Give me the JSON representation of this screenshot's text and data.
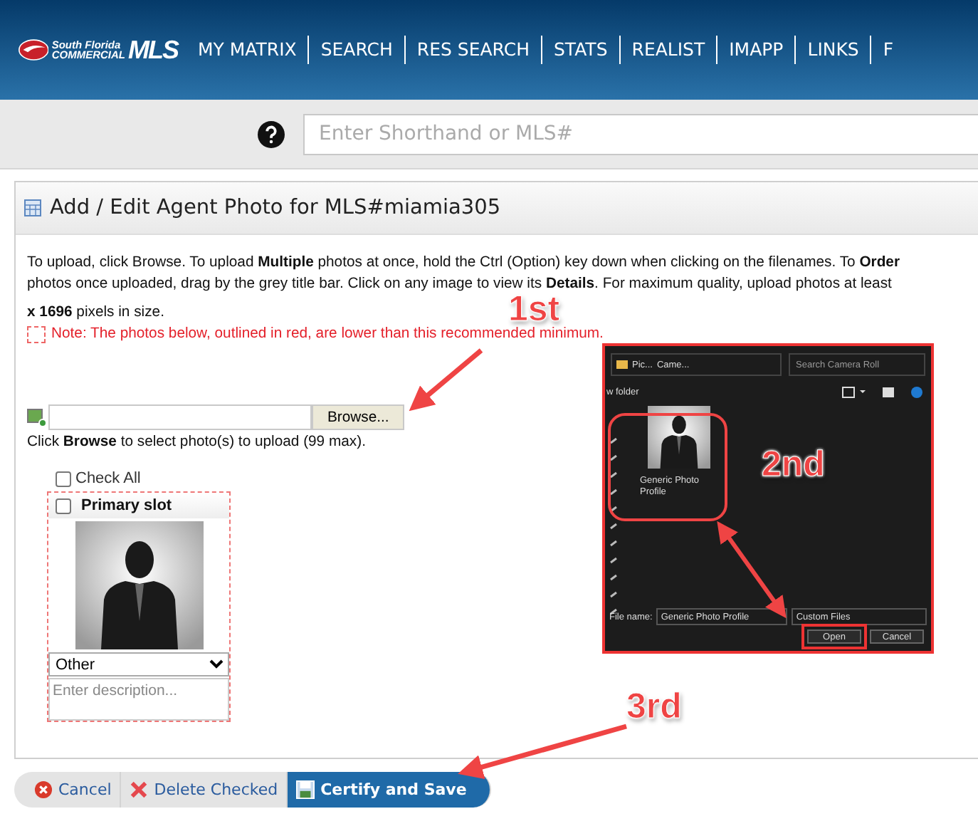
{
  "header": {
    "logo": {
      "line_1": "South Florida",
      "line_2": "COMMERCIAL",
      "mark": "MLS"
    },
    "nav": [
      "MY MATRIX",
      "SEARCH",
      "RES SEARCH",
      "STATS",
      "REALIST",
      "IMAPP",
      "LINKS",
      "F"
    ]
  },
  "search": {
    "placeholder": "Enter Shorthand or MLS#"
  },
  "panel": {
    "title": "Add / Edit Agent Photo for MLS#miamia305",
    "instructions": [
      "To upload, click Browse. To upload **Multiple** photos at once, hold the Ctrl (Option) key down when clicking on the filenames. To **Order**",
      "photos once uploaded, drag by the grey title bar. Click on any image to view its **Details**. For maximum quality, upload photos at least",
      "**x 1696** pixels in size."
    ],
    "note": "Note: The photos below, outlined in red, are lower than this recommended minimum.",
    "upload": {
      "button": "Browse...",
      "hint": "Click **Browse** to select photo(s) to upload (99 max)."
    },
    "check_all": {
      "label": "Check All",
      "checked": false
    },
    "photos": [
      {
        "title": "Primary slot",
        "checked": false,
        "category": "Other",
        "description_placeholder": "Enter description..."
      }
    ]
  },
  "actions": [
    {
      "label": "Cancel",
      "kind": "cancel"
    },
    {
      "label": "Delete Checked",
      "kind": "delete"
    },
    {
      "label": "Certify and Save",
      "kind": "save"
    }
  ],
  "file_dialog": {
    "breadcrumb": [
      "Pic...",
      "Came..."
    ],
    "search_placeholder": "Search Camera Roll",
    "toolbar_label": "w folder",
    "file": {
      "name": "Generic Photo Profile"
    },
    "file_name_label": "File name:",
    "file_name": "Generic Photo Profile",
    "file_type": "Custom Files",
    "buttons": [
      "Open",
      "Cancel"
    ]
  },
  "annotations": [
    {
      "label": "1st"
    },
    {
      "label": "2nd"
    },
    {
      "label": "3rd"
    }
  ]
}
